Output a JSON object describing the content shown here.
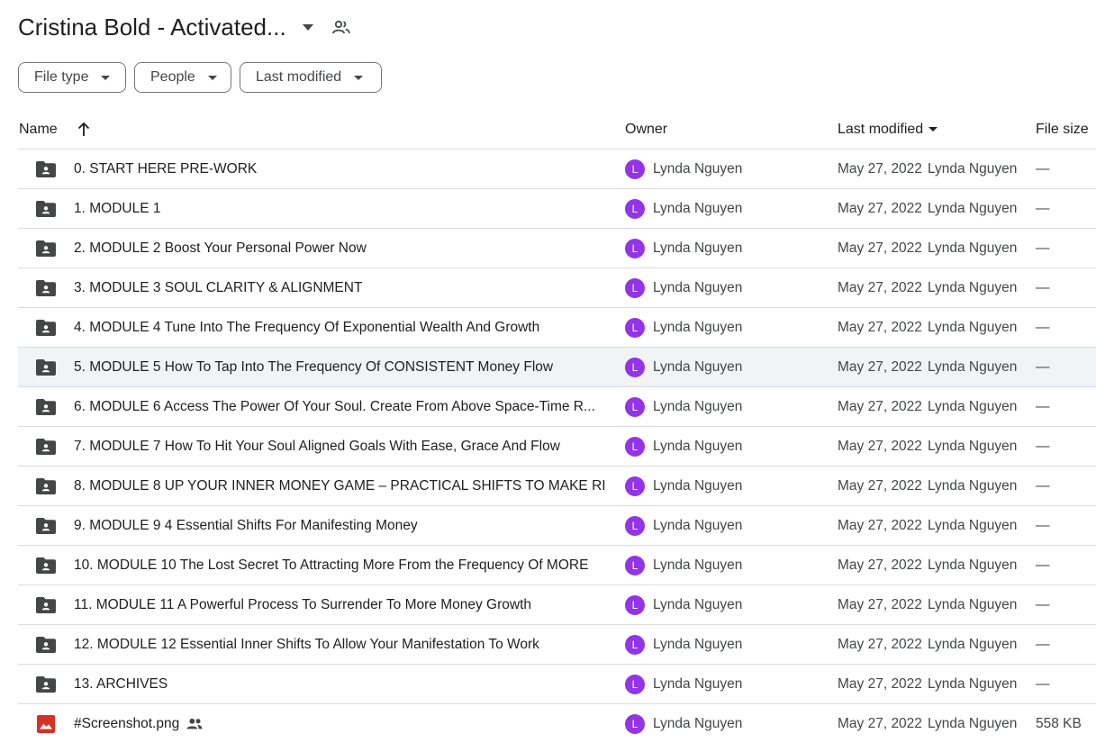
{
  "header": {
    "title": "Cristina Bold - Activated...",
    "caret_icon": "arrow-drop-down-icon",
    "shared_icon": "shared-people-icon"
  },
  "filters": {
    "file_type": "File type",
    "people": "People",
    "last_modified": "Last modified"
  },
  "columns": {
    "name": "Name",
    "owner": "Owner",
    "last_modified": "Last modified",
    "file_size": "File size"
  },
  "colors": {
    "avatar": "#9334e6",
    "folder": "#444746",
    "image_icon": "#d93025",
    "hover_row": "#f1f3f4"
  },
  "rows": [
    {
      "name": "0. START HERE  PRE-WORK",
      "type": "shared-folder",
      "owner_initial": "L",
      "owner": "Lynda Nguyen",
      "date": "May 27, 2022",
      "modified_by": "Lynda Nguyen",
      "size": "—"
    },
    {
      "name": "1. MODULE 1",
      "type": "shared-folder",
      "owner_initial": "L",
      "owner": "Lynda Nguyen",
      "date": "May 27, 2022",
      "modified_by": "Lynda Nguyen",
      "size": "—"
    },
    {
      "name": "2. MODULE 2 Boost Your Personal Power Now",
      "type": "shared-folder",
      "owner_initial": "L",
      "owner": "Lynda Nguyen",
      "date": "May 27, 2022",
      "modified_by": "Lynda Nguyen",
      "size": "—"
    },
    {
      "name": "3. MODULE 3 SOUL CLARITY & ALIGNMENT",
      "type": "shared-folder",
      "owner_initial": "L",
      "owner": "Lynda Nguyen",
      "date": "May 27, 2022",
      "modified_by": "Lynda Nguyen",
      "size": "—"
    },
    {
      "name": "4. MODULE 4 Tune Into The Frequency Of Exponential Wealth And Growth",
      "type": "shared-folder",
      "owner_initial": "L",
      "owner": "Lynda Nguyen",
      "date": "May 27, 2022",
      "modified_by": "Lynda Nguyen",
      "size": "—"
    },
    {
      "name": "5. MODULE 5 How To Tap Into The Frequency Of CONSISTENT Money Flow",
      "type": "shared-folder",
      "owner_initial": "L",
      "owner": "Lynda Nguyen",
      "date": "May 27, 2022",
      "modified_by": "Lynda Nguyen",
      "size": "—"
    },
    {
      "name": "6. MODULE 6 Access The Power Of Your Soul. Create From Above Space-Time R...",
      "type": "shared-folder",
      "owner_initial": "L",
      "owner": "Lynda Nguyen",
      "date": "May 27, 2022",
      "modified_by": "Lynda Nguyen",
      "size": "—"
    },
    {
      "name": "7. MODULE 7 How To Hit Your Soul Aligned Goals With Ease, Grace And Flow",
      "type": "shared-folder",
      "owner_initial": "L",
      "owner": "Lynda Nguyen",
      "date": "May 27, 2022",
      "modified_by": "Lynda Nguyen",
      "size": "—"
    },
    {
      "name": "8. MODULE 8 UP YOUR INNER MONEY GAME – PRACTICAL SHIFTS TO MAKE RI...",
      "type": "shared-folder",
      "owner_initial": "L",
      "owner": "Lynda Nguyen",
      "date": "May 27, 2022",
      "modified_by": "Lynda Nguyen",
      "size": "—"
    },
    {
      "name": "9. MODULE 9 4 Essential Shifts For Manifesting Money",
      "type": "shared-folder",
      "owner_initial": "L",
      "owner": "Lynda Nguyen",
      "date": "May 27, 2022",
      "modified_by": "Lynda Nguyen",
      "size": "—"
    },
    {
      "name": "10. MODULE 10 The Lost Secret To Attracting More From the Frequency Of MORE",
      "type": "shared-folder",
      "owner_initial": "L",
      "owner": "Lynda Nguyen",
      "date": "May 27, 2022",
      "modified_by": "Lynda Nguyen",
      "size": "—"
    },
    {
      "name": "11. MODULE 11 A Powerful Process To Surrender To More Money Growth",
      "type": "shared-folder",
      "owner_initial": "L",
      "owner": "Lynda Nguyen",
      "date": "May 27, 2022",
      "modified_by": "Lynda Nguyen",
      "size": "—"
    },
    {
      "name": "12. MODULE 12 Essential Inner Shifts To Allow Your Manifestation To Work",
      "type": "shared-folder",
      "owner_initial": "L",
      "owner": "Lynda Nguyen",
      "date": "May 27, 2022",
      "modified_by": "Lynda Nguyen",
      "size": "—"
    },
    {
      "name": "13. ARCHIVES",
      "type": "shared-folder",
      "owner_initial": "L",
      "owner": "Lynda Nguyen",
      "date": "May 27, 2022",
      "modified_by": "Lynda Nguyen",
      "size": "—"
    },
    {
      "name": "#Screenshot.png",
      "type": "image",
      "shared": true,
      "owner_initial": "L",
      "owner": "Lynda Nguyen",
      "date": "May 27, 2022",
      "modified_by": "Lynda Nguyen",
      "size": "558 KB"
    }
  ]
}
